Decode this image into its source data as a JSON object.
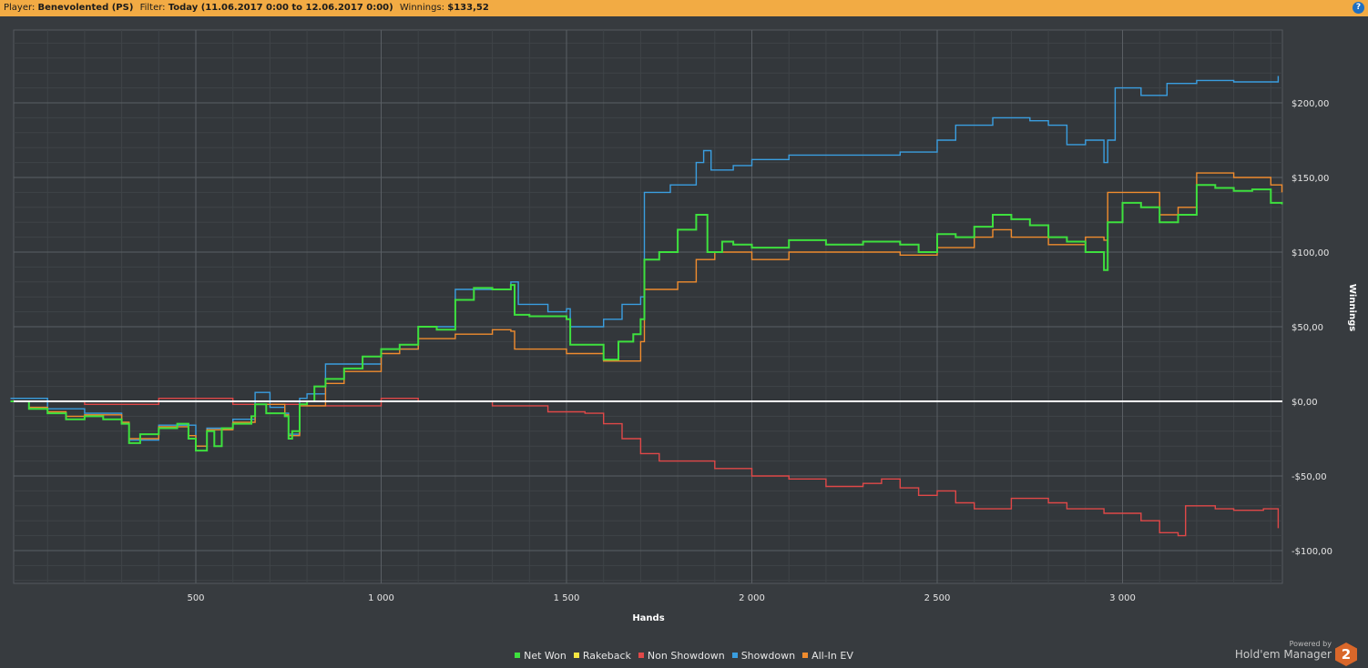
{
  "header": {
    "player_label": "Player:",
    "player": "Benevolented (PS)",
    "filter_label": "Filter:",
    "filter": "Today (11.06.2017 0:00 to 12.06.2017 0:00)",
    "winnings_label": "Winnings:",
    "winnings": "$133,52",
    "help_icon": "?"
  },
  "branding": {
    "powered_by": "Powered by",
    "product": "Hold'em Manager",
    "logo_text": "2"
  },
  "chart_data": {
    "type": "line",
    "xlabel": "Hands",
    "ylabel": "Winnings",
    "xlim": [
      0,
      3430
    ],
    "ylim": [
      -122,
      250
    ],
    "x_ticks": [
      500,
      1000,
      1500,
      2000,
      2500,
      3000
    ],
    "x_tick_labels": [
      "500",
      "1 000",
      "1 500",
      "2 000",
      "2 500",
      "3 000"
    ],
    "y_ticks": [
      -100,
      -50,
      0,
      50,
      100,
      150,
      200
    ],
    "y_tick_labels": [
      "-$100,00",
      "-$50,00",
      "$0,00",
      "$50,00",
      "$100,00",
      "$150,00",
      "$200,00"
    ],
    "grid": true,
    "legend_position": "bottom-center",
    "series": [
      {
        "name": "Rakeback",
        "color": "#f5e642",
        "points": [
          [
            0,
            0
          ],
          [
            3430,
            0
          ]
        ]
      },
      {
        "name": "Non Showdown",
        "color": "#e04848",
        "points": [
          [
            0,
            0
          ],
          [
            200,
            -2
          ],
          [
            400,
            2
          ],
          [
            600,
            -2
          ],
          [
            800,
            -3
          ],
          [
            1000,
            2
          ],
          [
            1100,
            0
          ],
          [
            1200,
            0
          ],
          [
            1300,
            -3
          ],
          [
            1450,
            -7
          ],
          [
            1550,
            -8
          ],
          [
            1600,
            -15
          ],
          [
            1650,
            -25
          ],
          [
            1700,
            -35
          ],
          [
            1750,
            -40
          ],
          [
            1800,
            -40
          ],
          [
            1900,
            -45
          ],
          [
            2000,
            -50
          ],
          [
            2100,
            -52
          ],
          [
            2200,
            -57
          ],
          [
            2300,
            -55
          ],
          [
            2350,
            -52
          ],
          [
            2400,
            -58
          ],
          [
            2450,
            -63
          ],
          [
            2500,
            -60
          ],
          [
            2550,
            -68
          ],
          [
            2600,
            -72
          ],
          [
            2700,
            -65
          ],
          [
            2800,
            -68
          ],
          [
            2850,
            -72
          ],
          [
            2900,
            -72
          ],
          [
            2950,
            -75
          ],
          [
            3000,
            -75
          ],
          [
            3050,
            -80
          ],
          [
            3100,
            -88
          ],
          [
            3150,
            -90
          ],
          [
            3170,
            -70
          ],
          [
            3250,
            -72
          ],
          [
            3300,
            -73
          ],
          [
            3380,
            -72
          ],
          [
            3420,
            -85
          ]
        ]
      },
      {
        "name": "Showdown",
        "color": "#3a9ee0",
        "points": [
          [
            0,
            2
          ],
          [
            50,
            2
          ],
          [
            100,
            -5
          ],
          [
            200,
            -8
          ],
          [
            300,
            -15
          ],
          [
            320,
            -26
          ],
          [
            400,
            -16
          ],
          [
            500,
            -30
          ],
          [
            530,
            -18
          ],
          [
            600,
            -12
          ],
          [
            660,
            6
          ],
          [
            700,
            -4
          ],
          [
            740,
            -8
          ],
          [
            750,
            -22
          ],
          [
            780,
            2
          ],
          [
            800,
            5
          ],
          [
            850,
            25
          ],
          [
            1000,
            35
          ],
          [
            1100,
            50
          ],
          [
            1200,
            75
          ],
          [
            1350,
            80
          ],
          [
            1370,
            65
          ],
          [
            1450,
            60
          ],
          [
            1500,
            62
          ],
          [
            1510,
            50
          ],
          [
            1600,
            55
          ],
          [
            1650,
            65
          ],
          [
            1700,
            70
          ],
          [
            1710,
            140
          ],
          [
            1780,
            145
          ],
          [
            1850,
            160
          ],
          [
            1870,
            168
          ],
          [
            1890,
            155
          ],
          [
            1950,
            158
          ],
          [
            2000,
            162
          ],
          [
            2100,
            165
          ],
          [
            2200,
            165
          ],
          [
            2400,
            167
          ],
          [
            2500,
            175
          ],
          [
            2550,
            185
          ],
          [
            2650,
            190
          ],
          [
            2750,
            188
          ],
          [
            2800,
            185
          ],
          [
            2850,
            172
          ],
          [
            2900,
            175
          ],
          [
            2950,
            160
          ],
          [
            2960,
            175
          ],
          [
            2980,
            210
          ],
          [
            3050,
            205
          ],
          [
            3120,
            213
          ],
          [
            3200,
            215
          ],
          [
            3300,
            214
          ],
          [
            3400,
            214
          ],
          [
            3420,
            218
          ]
        ]
      },
      {
        "name": "All-In EV",
        "color": "#f08c2e",
        "points": [
          [
            0,
            0
          ],
          [
            50,
            -4
          ],
          [
            100,
            -7
          ],
          [
            150,
            -10
          ],
          [
            200,
            -9
          ],
          [
            300,
            -14
          ],
          [
            320,
            -25
          ],
          [
            400,
            -17
          ],
          [
            480,
            -23
          ],
          [
            500,
            -30
          ],
          [
            530,
            -19
          ],
          [
            600,
            -14
          ],
          [
            660,
            -2
          ],
          [
            740,
            -9
          ],
          [
            750,
            -23
          ],
          [
            780,
            -3
          ],
          [
            850,
            12
          ],
          [
            900,
            20
          ],
          [
            1000,
            32
          ],
          [
            1050,
            35
          ],
          [
            1100,
            42
          ],
          [
            1200,
            45
          ],
          [
            1300,
            48
          ],
          [
            1350,
            47
          ],
          [
            1360,
            35
          ],
          [
            1500,
            32
          ],
          [
            1600,
            27
          ],
          [
            1700,
            40
          ],
          [
            1710,
            75
          ],
          [
            1800,
            80
          ],
          [
            1850,
            95
          ],
          [
            1900,
            100
          ],
          [
            2000,
            95
          ],
          [
            2100,
            100
          ],
          [
            2200,
            100
          ],
          [
            2300,
            100
          ],
          [
            2400,
            98
          ],
          [
            2500,
            103
          ],
          [
            2600,
            110
          ],
          [
            2650,
            115
          ],
          [
            2700,
            110
          ],
          [
            2800,
            105
          ],
          [
            2900,
            110
          ],
          [
            2950,
            108
          ],
          [
            2960,
            140
          ],
          [
            3000,
            140
          ],
          [
            3100,
            125
          ],
          [
            3150,
            130
          ],
          [
            3200,
            153
          ],
          [
            3300,
            150
          ],
          [
            3400,
            145
          ],
          [
            3430,
            140
          ]
        ]
      },
      {
        "name": "Net Won",
        "color": "#3ee03e",
        "points": [
          [
            0,
            0
          ],
          [
            50,
            -5
          ],
          [
            100,
            -8
          ],
          [
            150,
            -12
          ],
          [
            200,
            -10
          ],
          [
            250,
            -12
          ],
          [
            300,
            -15
          ],
          [
            320,
            -28
          ],
          [
            350,
            -22
          ],
          [
            400,
            -18
          ],
          [
            450,
            -15
          ],
          [
            480,
            -25
          ],
          [
            500,
            -33
          ],
          [
            530,
            -20
          ],
          [
            550,
            -30
          ],
          [
            570,
            -18
          ],
          [
            600,
            -15
          ],
          [
            650,
            -10
          ],
          [
            660,
            -2
          ],
          [
            690,
            -8
          ],
          [
            740,
            -10
          ],
          [
            750,
            -25
          ],
          [
            760,
            -20
          ],
          [
            780,
            -2
          ],
          [
            800,
            0
          ],
          [
            820,
            10
          ],
          [
            850,
            15
          ],
          [
            900,
            22
          ],
          [
            950,
            30
          ],
          [
            1000,
            35
          ],
          [
            1050,
            38
          ],
          [
            1100,
            50
          ],
          [
            1150,
            48
          ],
          [
            1200,
            68
          ],
          [
            1250,
            76
          ],
          [
            1300,
            75
          ],
          [
            1350,
            78
          ],
          [
            1360,
            58
          ],
          [
            1400,
            57
          ],
          [
            1500,
            55
          ],
          [
            1510,
            38
          ],
          [
            1560,
            38
          ],
          [
            1600,
            28
          ],
          [
            1640,
            40
          ],
          [
            1680,
            45
          ],
          [
            1700,
            55
          ],
          [
            1710,
            95
          ],
          [
            1750,
            100
          ],
          [
            1800,
            115
          ],
          [
            1850,
            125
          ],
          [
            1880,
            100
          ],
          [
            1920,
            107
          ],
          [
            1950,
            105
          ],
          [
            2000,
            103
          ],
          [
            2100,
            108
          ],
          [
            2200,
            105
          ],
          [
            2300,
            107
          ],
          [
            2400,
            105
          ],
          [
            2450,
            100
          ],
          [
            2500,
            112
          ],
          [
            2550,
            110
          ],
          [
            2600,
            117
          ],
          [
            2650,
            125
          ],
          [
            2700,
            122
          ],
          [
            2750,
            118
          ],
          [
            2800,
            110
          ],
          [
            2850,
            107
          ],
          [
            2900,
            100
          ],
          [
            2950,
            88
          ],
          [
            2960,
            120
          ],
          [
            3000,
            133
          ],
          [
            3050,
            130
          ],
          [
            3100,
            120
          ],
          [
            3150,
            125
          ],
          [
            3200,
            145
          ],
          [
            3250,
            143
          ],
          [
            3300,
            141
          ],
          [
            3350,
            142
          ],
          [
            3400,
            133
          ],
          [
            3430,
            132
          ]
        ]
      }
    ],
    "legend": [
      "Net Won",
      "Rakeback",
      "Non Showdown",
      "Showdown",
      "All-In EV"
    ],
    "legend_colors": [
      "#3ee03e",
      "#f5e642",
      "#e04848",
      "#3a9ee0",
      "#f08c2e"
    ]
  }
}
